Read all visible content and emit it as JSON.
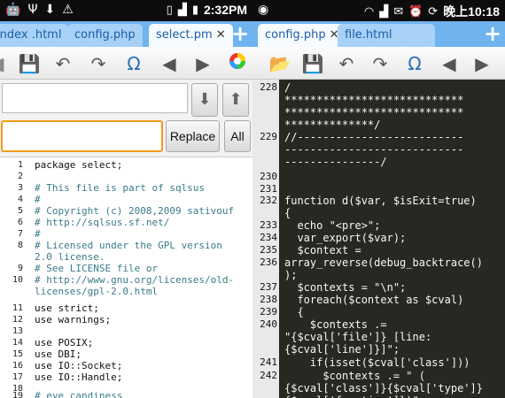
{
  "left": {
    "status": {
      "time": "2:32PM",
      "icons": [
        "android-icon",
        "usb-icon",
        "download-icon",
        "alert-icon",
        "vibrate-icon",
        "signal-icon",
        "battery-icon"
      ]
    },
    "tabs": [
      {
        "label": "index .html"
      },
      {
        "label": "config.php"
      },
      {
        "label": "select.pm",
        "active": true,
        "close": "✕"
      }
    ],
    "tab_add": "+",
    "find": {
      "find_value": "",
      "replace_value": "",
      "replace_label": "Replace",
      "all_label": "All"
    },
    "code": [
      {
        "n": "1",
        "t": "package select;"
      },
      {
        "n": "2",
        "t": ""
      },
      {
        "n": "3",
        "t": "# This file is part of sqlsus",
        "c": true
      },
      {
        "n": "4",
        "t": "#",
        "c": true
      },
      {
        "n": "5",
        "t": "# Copyright (c) 2008,2009 sativouf",
        "c": true
      },
      {
        "n": "6",
        "t": "# http://sqlsus.sf.net/",
        "c": true
      },
      {
        "n": "7",
        "t": "#",
        "c": true
      },
      {
        "n": "8",
        "t": "# Licensed under the GPL version\n2.0 license.",
        "c": true
      },
      {
        "n": "9",
        "t": "# See LICENSE file or",
        "c": true
      },
      {
        "n": "10",
        "t": "# http://www.gnu.org/licenses/old-\nlicenses/gpl-2.0.html",
        "c": true
      },
      {
        "n": "11",
        "t": "use strict;"
      },
      {
        "n": "12",
        "t": "use warnings;"
      },
      {
        "n": "13",
        "t": ""
      },
      {
        "n": "14",
        "t": "use POSIX;"
      },
      {
        "n": "15",
        "t": "use DBI;"
      },
      {
        "n": "16",
        "t": "use IO::Socket;"
      },
      {
        "n": "17",
        "t": "use IO::Handle;"
      },
      {
        "n": "18",
        "t": ""
      },
      {
        "n": "19",
        "t": "# eye candiness",
        "c": true
      }
    ]
  },
  "right": {
    "status": {
      "time": "晚上10:18",
      "icons": [
        "globe-icon",
        "wifi-icon",
        "signal-icon",
        "envelope-icon",
        "alarm-icon",
        "sync-icon"
      ]
    },
    "tabs": [
      {
        "label": "config.php",
        "active": true,
        "close": "✕"
      },
      {
        "label": "file.html"
      }
    ],
    "tab_add": "+",
    "code": [
      {
        "n": "228",
        "t": "/\n****************************\n****************************\n**************/"
      },
      {
        "n": "229",
        "t": "//--------------------------\n----------------------------\n---------------/"
      },
      {
        "n": "230",
        "t": ""
      },
      {
        "n": "231",
        "t": ""
      },
      {
        "n": "232",
        "t": "function d($var, $isExit=true)\n{"
      },
      {
        "n": "233",
        "t": "  echo \"<pre>\";"
      },
      {
        "n": "234",
        "t": "  var_export($var);"
      },
      {
        "n": "235",
        "t": "  $context ="
      },
      {
        "n": "236",
        "t": "array_reverse(debug_backtrace()\n);"
      },
      {
        "n": "237",
        "t": "  $contexts = \"\\n\";"
      },
      {
        "n": "238",
        "t": "  foreach($context as $cval)"
      },
      {
        "n": "239",
        "t": "  {"
      },
      {
        "n": "240",
        "t": "    $contexts .=\n\"{$cval['file']} [line:\n{$cval['line']}]\";"
      },
      {
        "n": "241",
        "t": "    if(isset($cval['class']))"
      },
      {
        "n": "242",
        "t": "      $contexts .= \" (\n{$cval['class']}{$cval['type']}\n{$cval['function']})\";"
      }
    ]
  }
}
